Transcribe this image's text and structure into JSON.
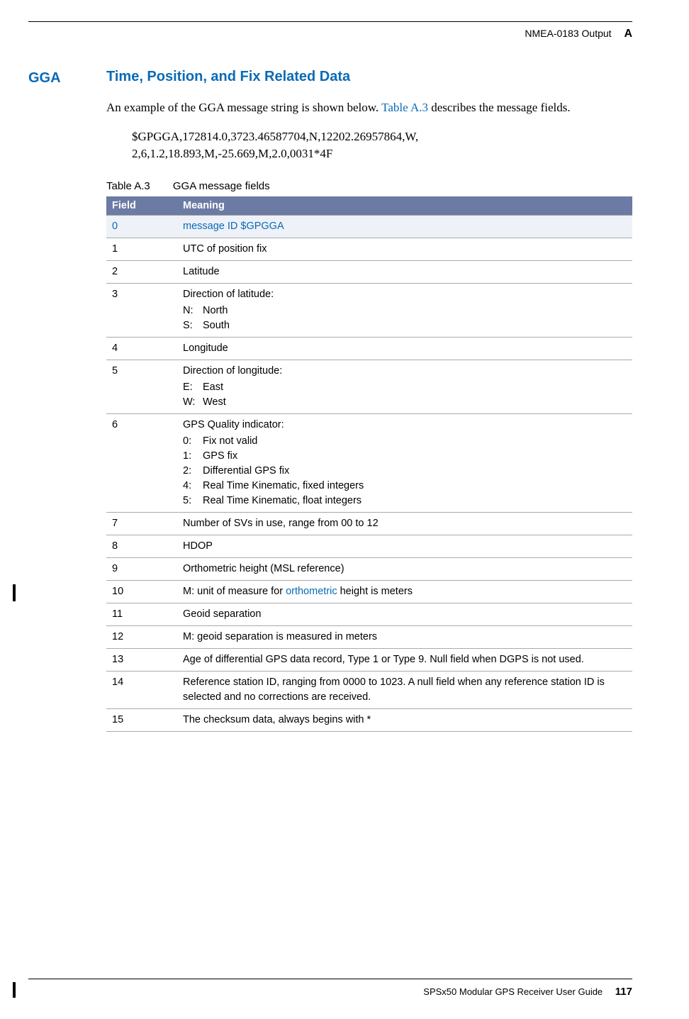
{
  "header": {
    "section_label": "NMEA-0183 Output",
    "section_letter": "A"
  },
  "section": {
    "tag": "GGA",
    "title": "Time, Position, and Fix Related Data",
    "intro_pre": "An example of the GGA message string is shown below. ",
    "intro_link": "Table A.3",
    "intro_post": " describes the message fields.",
    "example_l1": "$GPGGA,172814.0,3723.46587704,N,12202.26957864,W,",
    "example_l2": "2,6,1.2,18.893,M,-25.669,M,2.0,0031*4F"
  },
  "table": {
    "label": "Table A.3",
    "title": "GGA message fields",
    "col_field": "Field",
    "col_meaning": "Meaning",
    "rows": [
      {
        "field": "0",
        "meaning": "message ID $GPGGA",
        "highlight": true
      },
      {
        "field": "1",
        "meaning": "UTC of position fix"
      },
      {
        "field": "2",
        "meaning": "Latitude"
      },
      {
        "field": "3",
        "meaning": "Direction of latitude:",
        "sub": [
          {
            "k": "N:",
            "v": "North"
          },
          {
            "k": "S:",
            "v": "South"
          }
        ]
      },
      {
        "field": "4",
        "meaning": "Longitude"
      },
      {
        "field": "5",
        "meaning": "Direction of longitude:",
        "sub": [
          {
            "k": "E:",
            "v": "East"
          },
          {
            "k": "W:",
            "v": "West"
          }
        ]
      },
      {
        "field": "6",
        "meaning": "GPS Quality indicator:",
        "sub": [
          {
            "k": "0:",
            "v": "Fix not valid"
          },
          {
            "k": "1:",
            "v": "GPS fix"
          },
          {
            "k": "2:",
            "v": "Differential GPS fix"
          },
          {
            "k": "4:",
            "v": "Real Time Kinematic, fixed integers"
          },
          {
            "k": "5:",
            "v": "Real Time Kinematic, float integers"
          }
        ]
      },
      {
        "field": "7",
        "meaning": "Number of SVs in use, range from 00 to 12"
      },
      {
        "field": "8",
        "meaning": "HDOP"
      },
      {
        "field": "9",
        "meaning": "Orthometric height (MSL reference)"
      },
      {
        "field": "10",
        "meaning_pre": "M:   unit of measure for ",
        "meaning_link": "orthometric",
        "meaning_post": " height is meters"
      },
      {
        "field": "11",
        "meaning": "Geoid separation"
      },
      {
        "field": "12",
        "meaning": "M:  geoid separation is measured in meters"
      },
      {
        "field": "13",
        "meaning": "Age of differential GPS data record, Type 1 or Type 9. Null field when DGPS is not used."
      },
      {
        "field": "14",
        "meaning": "Reference station ID, ranging from 0000 to 1023. A null field when any reference station ID is selected and no corrections are received."
      },
      {
        "field": "15",
        "meaning": "The checksum data, always begins with *"
      }
    ]
  },
  "footer": {
    "guide": "SPSx50 Modular GPS Receiver User Guide",
    "page": "117"
  }
}
